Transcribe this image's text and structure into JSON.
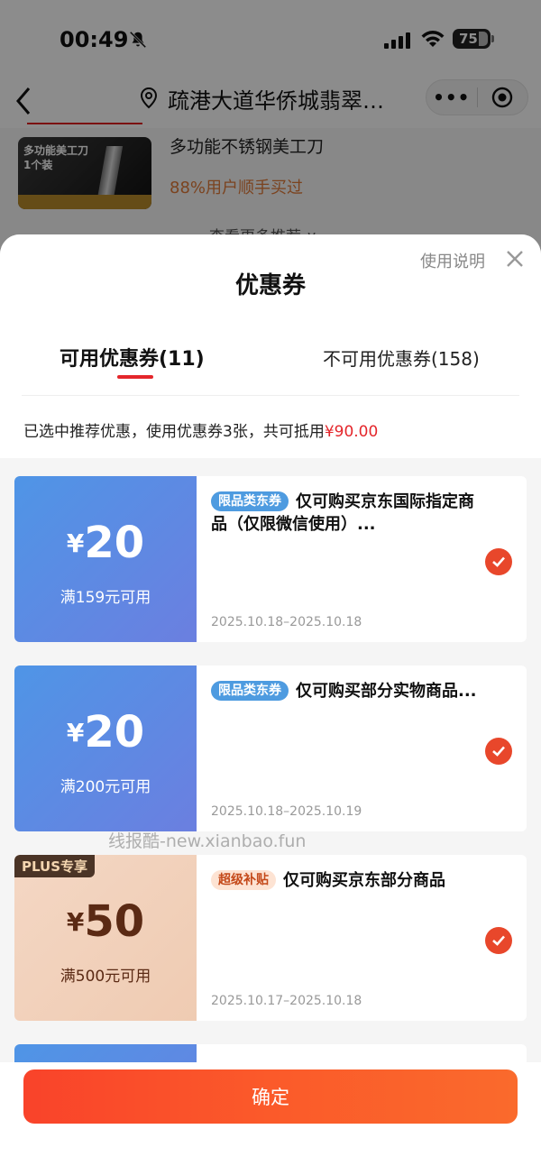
{
  "status_bar": {
    "time": "00:49",
    "battery": "75"
  },
  "nav": {
    "location": "疏港大道华侨城翡翠…",
    "more_label": "•••"
  },
  "background_product": {
    "image_text_1": "多功能美工刀",
    "image_text_2": "1个装",
    "name": "多功能不锈钢美工刀",
    "subtitle": "88%用户顺手买过",
    "see_more": "查看更多推荐 ∨"
  },
  "sheet": {
    "help": "使用说明",
    "title": "优惠券",
    "tab_available": "可用优惠券(11)",
    "tab_unavailable": "不可用优惠券(158)",
    "summary_prefix": "已选中推荐优惠，使用优惠券3张，共可抵用",
    "summary_amount": "¥90.00",
    "confirm": "确定",
    "accent": "#e4262b"
  },
  "coupons": [
    {
      "yen": "¥",
      "amount": "20",
      "condition": "满159元可用",
      "tag": "限品类东券",
      "title": "仅可购买京东国际指定商品（仅限微信使用）...",
      "date": "2025.10.18–2025.10.18"
    },
    {
      "yen": "¥",
      "amount": "20",
      "condition": "满200元可用",
      "tag": "限品类东券",
      "title": "仅可购买部分实物商品...",
      "date": "2025.10.18–2025.10.19"
    },
    {
      "badge": "PLUS专享",
      "yen": "¥",
      "amount": "50",
      "condition": "满500元可用",
      "tag": "超级补贴",
      "title": "仅可购买京东部分商品",
      "date": "2025.10.17–2025.10.18"
    }
  ],
  "watermark": "线报酷-new.xianbao.fun"
}
